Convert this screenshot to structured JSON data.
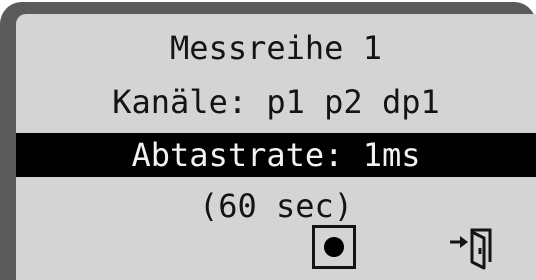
{
  "screen": {
    "title": "Messreihe 1",
    "channels": "Kanäle: p1 p2 dp1",
    "sample_rate": "Abtastrate: 1ms",
    "duration": "(60 sec)"
  },
  "softkeys": {
    "record_icon": "record-icon",
    "exit_icon": "exit-door-icon"
  },
  "colors": {
    "lcd_background": "#d4d4d4",
    "bezel": "#5a5a5a",
    "text": "#141414",
    "highlight": "#000000"
  }
}
